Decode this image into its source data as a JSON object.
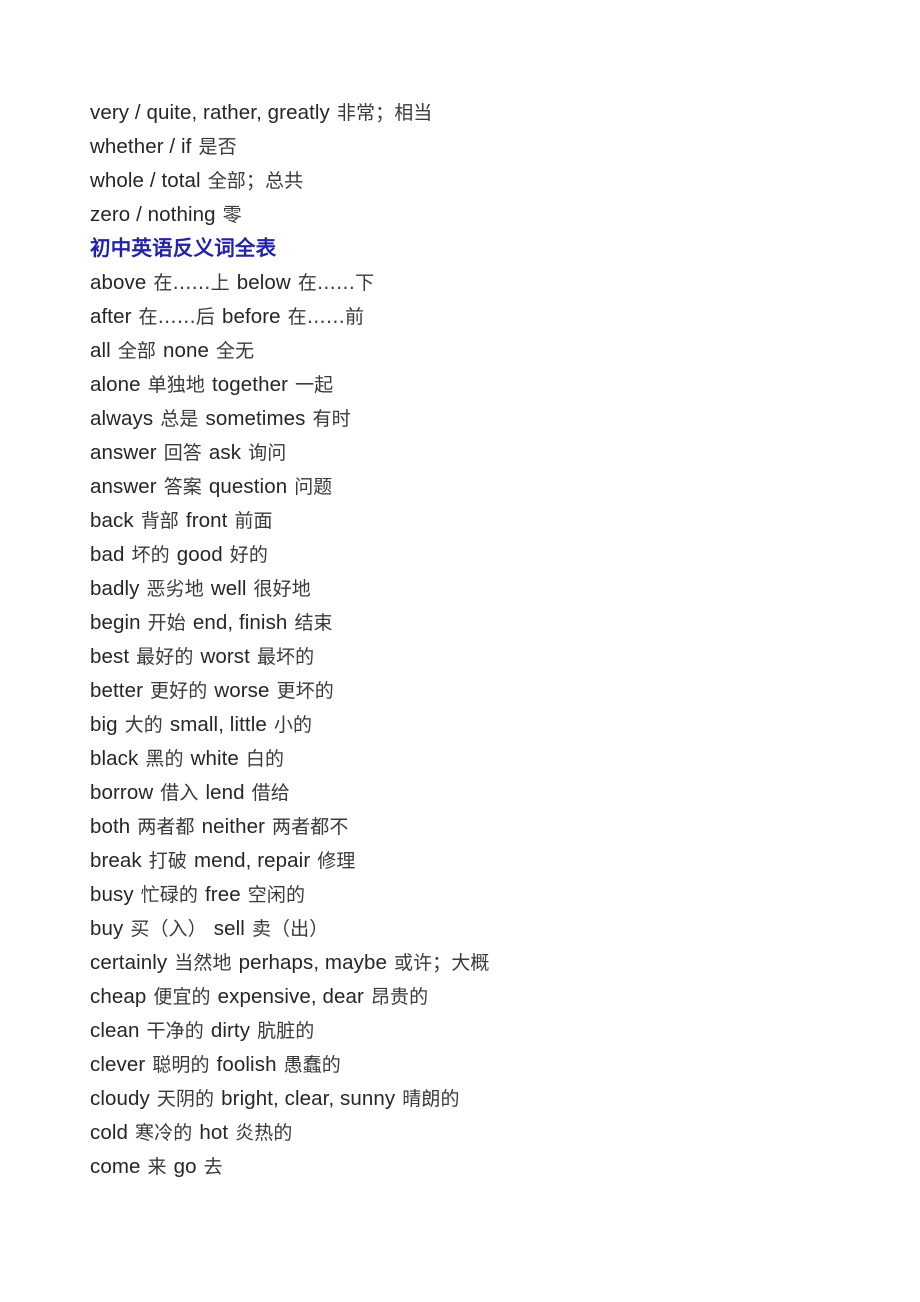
{
  "document": {
    "background_color": "#ffffff",
    "text_color": "#262626",
    "heading_color": "#2222aa"
  },
  "heading": {
    "text": "初中英语反义词全表"
  },
  "synonym_lines": [
    {
      "en": "very / quite, rather, greatly",
      "zh": "非常；相当"
    },
    {
      "en": "whether / if",
      "zh": "是否"
    },
    {
      "en": "whole / total",
      "zh": "全部；总共"
    },
    {
      "en": "zero / nothing",
      "zh": "零"
    }
  ],
  "antonym_entries": [
    {
      "word1": "above",
      "meaning1": "在……上",
      "word2": "below",
      "meaning2": "在……下"
    },
    {
      "word1": "after",
      "meaning1": "在……后",
      "word2": "before",
      "meaning2": "在……前"
    },
    {
      "word1": "all",
      "meaning1": "全部",
      "word2": "none",
      "meaning2": "全无"
    },
    {
      "word1": "alone",
      "meaning1": "单独地",
      "word2": "together",
      "meaning2": "一起"
    },
    {
      "word1": "always",
      "meaning1": "总是",
      "word2": "sometimes",
      "meaning2": "有时"
    },
    {
      "word1": "answer",
      "meaning1": "回答",
      "word2": "ask",
      "meaning2": "询问"
    },
    {
      "word1": "answer",
      "meaning1": "答案",
      "word2": "question",
      "meaning2": "问题"
    },
    {
      "word1": "back",
      "meaning1": "背部",
      "word2": "front",
      "meaning2": "前面"
    },
    {
      "word1": "bad",
      "meaning1": "坏的",
      "word2": "good",
      "meaning2": "好的"
    },
    {
      "word1": "badly",
      "meaning1": "恶劣地",
      "word2": "well",
      "meaning2": "很好地"
    },
    {
      "word1": "begin",
      "meaning1": "开始",
      "word2": "end, finish",
      "meaning2": "结束"
    },
    {
      "word1": "best",
      "meaning1": "最好的",
      "word2": "worst",
      "meaning2": "最坏的"
    },
    {
      "word1": "better",
      "meaning1": "更好的",
      "word2": "worse",
      "meaning2": "更坏的"
    },
    {
      "word1": "big",
      "meaning1": "大的",
      "word2": "small, little",
      "meaning2": "小的"
    },
    {
      "word1": "black",
      "meaning1": "黑的",
      "word2": "white",
      "meaning2": "白的"
    },
    {
      "word1": "borrow",
      "meaning1": "借入",
      "word2": "lend",
      "meaning2": "借给"
    },
    {
      "word1": "both",
      "meaning1": "两者都",
      "word2": "neither",
      "meaning2": "两者都不"
    },
    {
      "word1": "break",
      "meaning1": "打破",
      "word2": "mend, repair",
      "meaning2": "修理"
    },
    {
      "word1": "busy",
      "meaning1": "忙碌的",
      "word2": "free",
      "meaning2": "空闲的"
    },
    {
      "word1": "buy",
      "meaning1": "买（入）",
      "word2": "sell",
      "meaning2": "卖（出）"
    },
    {
      "word1": "certainly",
      "meaning1": "当然地",
      "word2": "perhaps, maybe",
      "meaning2": "或许；大概"
    },
    {
      "word1": "cheap",
      "meaning1": "便宜的",
      "word2": "expensive, dear",
      "meaning2": "昂贵的"
    },
    {
      "word1": "clean",
      "meaning1": "干净的",
      "word2": "dirty",
      "meaning2": "肮脏的"
    },
    {
      "word1": "clever",
      "meaning1": "聪明的",
      "word2": "foolish",
      "meaning2": "愚蠢的"
    },
    {
      "word1": "cloudy",
      "meaning1": "天阴的",
      "word2": "bright, clear, sunny",
      "meaning2": "晴朗的"
    },
    {
      "word1": "cold",
      "meaning1": "寒冷的",
      "word2": "hot",
      "meaning2": "炎热的"
    },
    {
      "word1": "come",
      "meaning1": "来",
      "word2": "go",
      "meaning2": "去"
    }
  ]
}
